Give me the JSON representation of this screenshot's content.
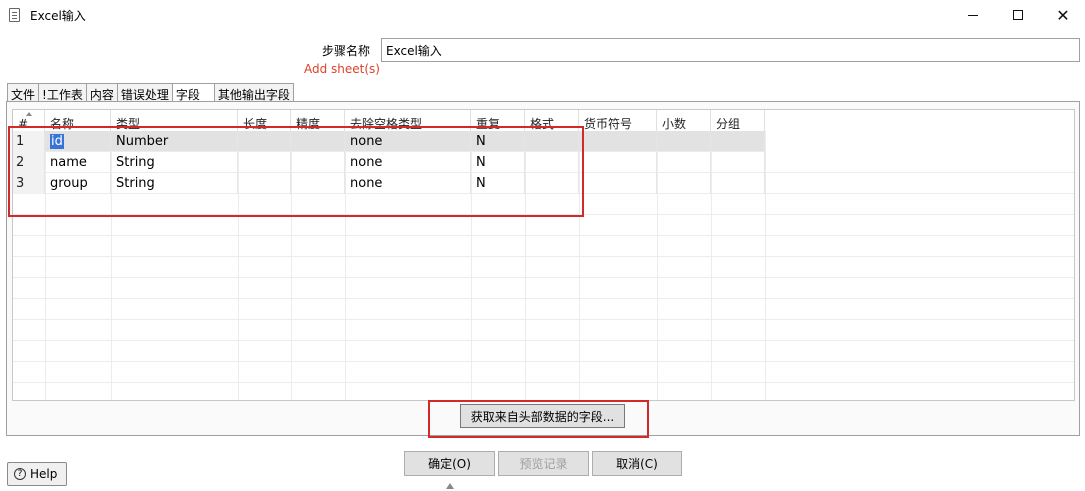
{
  "window": {
    "title": "Excel输入"
  },
  "step": {
    "label": "步骤名称",
    "value": "Excel输入"
  },
  "add_sheet_label": "Add sheet(s)",
  "tabs": [
    {
      "label": "文件"
    },
    {
      "label": "!工作表"
    },
    {
      "label": "内容"
    },
    {
      "label": "错误处理"
    },
    {
      "label": "字段",
      "active": true
    },
    {
      "label": "其他输出字段"
    }
  ],
  "table": {
    "columns": [
      "#",
      "名称",
      "类型",
      "长度",
      "精度",
      "去除空格类型",
      "重复",
      "格式",
      "货币符号",
      "小数",
      "分组"
    ],
    "rows": [
      [
        "1",
        "id",
        "Number",
        "",
        "",
        "none",
        "N",
        "",
        "",
        "",
        ""
      ],
      [
        "2",
        "name",
        "String",
        "",
        "",
        "none",
        "N",
        "",
        "",
        "",
        ""
      ],
      [
        "3",
        "group",
        "String",
        "",
        "",
        "none",
        "N",
        "",
        "",
        "",
        ""
      ]
    ]
  },
  "buttons": {
    "get_fields": "获取来自头部数据的字段...",
    "ok": "确定(O)",
    "preview": "预览记录",
    "cancel": "取消(C)",
    "help": "Help"
  },
  "icons": {
    "app": "document-icon",
    "minimize": "minimize-icon",
    "maximize": "maximize-icon",
    "close": "close-icon",
    "help": "help-icon"
  },
  "colors": {
    "annotation_red": "#d22a2a",
    "add_sheet_text": "#e0412a",
    "selection_blue": "#3874d8"
  }
}
